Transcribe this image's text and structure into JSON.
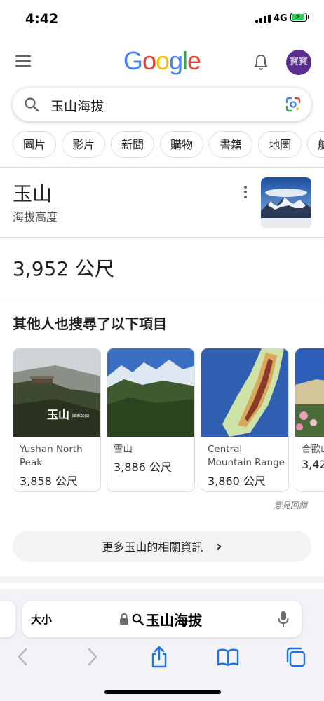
{
  "status_bar": {
    "time": "4:42",
    "network": "4G"
  },
  "header": {
    "logo_letters": [
      "G",
      "o",
      "o",
      "g",
      "l",
      "e"
    ],
    "logo_colors": [
      "#4285F4",
      "#EA4335",
      "#FBBC05",
      "#4285F4",
      "#34A853",
      "#EA4335"
    ],
    "avatar_label": "寶寶",
    "avatar_color": "#5b2d8e"
  },
  "search": {
    "query": "玉山海拔"
  },
  "chips": [
    "圖片",
    "影片",
    "新聞",
    "購物",
    "書籍",
    "地圖",
    "航"
  ],
  "entity": {
    "title": "玉山",
    "subtitle": "海拔高度"
  },
  "answer": {
    "value": "3,952 公尺"
  },
  "also_searched": {
    "heading": "其他人也搜尋了以下項目",
    "cards": [
      {
        "name": "Yushan North Peak",
        "value": "3,858 公尺",
        "image_text": "玉山",
        "image_small": "國家公園"
      },
      {
        "name": "雪山",
        "value": "3,886 公尺"
      },
      {
        "name": "Central Mountain Range",
        "value": "3,860 公尺"
      },
      {
        "name": "合歡山",
        "value": "3,42"
      }
    ],
    "feedback": "意見回饋"
  },
  "more_button": {
    "label": "更多玉山的相關資訊",
    "arrow": "›"
  },
  "safari": {
    "text_size_label": "大小",
    "address_text": "玉山海拔",
    "icons": [
      "back-icon",
      "forward-icon",
      "share-icon",
      "bookmarks-icon",
      "tabs-icon"
    ]
  }
}
